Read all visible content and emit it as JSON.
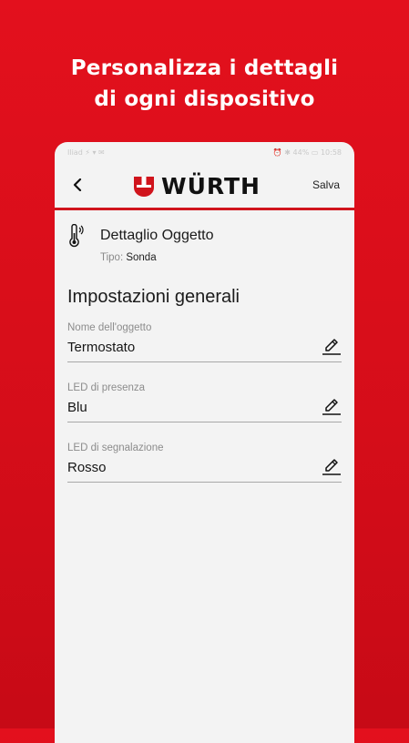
{
  "headline": {
    "line1": "Personalizza i dettagli",
    "line2": "di ogni dispositivo"
  },
  "statusbar": {
    "left": "Iliad  ⚡ ▾ ✉",
    "right": "⏰ ✱ 44%  ▭ 10:58"
  },
  "appbar": {
    "back_icon": "chevron-left-icon",
    "logo_text": "WÜRTH",
    "save_label": "Salva",
    "accent_color": "#d0141c"
  },
  "object": {
    "icon": "thermometer-icon",
    "title": "Dettaglio Oggetto",
    "type_label": "Tipo:",
    "type_value": "Sonda"
  },
  "section": {
    "title": "Impostazioni generali"
  },
  "fields": [
    {
      "label": "Nome dell'oggetto",
      "value": "Termostato",
      "icon": "pencil-icon"
    },
    {
      "label": "LED di presenza",
      "value": "Blu",
      "icon": "pencil-icon"
    },
    {
      "label": "LED di segnalazione",
      "value": "Rosso",
      "icon": "pencil-icon"
    }
  ],
  "colors": {
    "background": "#e3101d",
    "screen": "#f3f3f3",
    "text": "#1a1a1a"
  }
}
